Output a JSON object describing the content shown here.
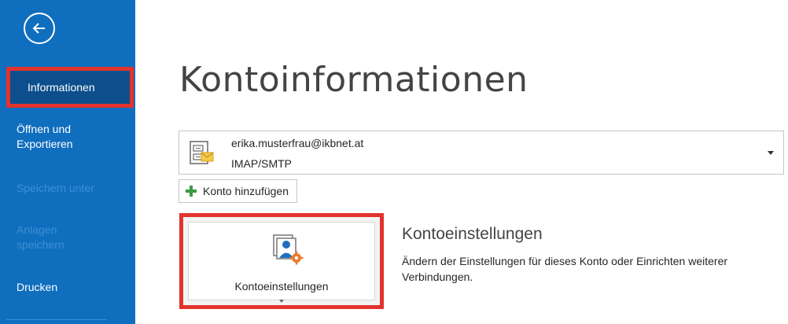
{
  "sidebar": {
    "back_label": "Zurück",
    "items": [
      {
        "label": "Informationen",
        "active": true
      },
      {
        "label": "Öffnen und Exportieren",
        "active": false
      },
      {
        "label": "Speichern unter",
        "active": false,
        "disabled": true
      },
      {
        "label": "Anlagen speichern",
        "active": false,
        "disabled": true
      },
      {
        "label": "Drucken",
        "active": false
      }
    ]
  },
  "main": {
    "title": "Kontoinformationen",
    "account": {
      "email": "erika.musterfrau@ikbnet.at",
      "type": "IMAP/SMTP"
    },
    "add_account_label": "Konto hinzufügen",
    "settings_tile_label": "Kontoeinstellungen",
    "section_title": "Kontoeinstellungen",
    "section_description": "Ändern der Einstellungen für dieses Konto oder Einrichten weiterer Verbindungen."
  },
  "colors": {
    "sidebar": "#106ebe",
    "highlight": "#e2332d",
    "plus_green": "#3a9b45"
  },
  "icons": [
    "back-arrow-icon",
    "account-mail-icon",
    "plus-icon",
    "account-settings-icon",
    "chevron-down-icon"
  ]
}
